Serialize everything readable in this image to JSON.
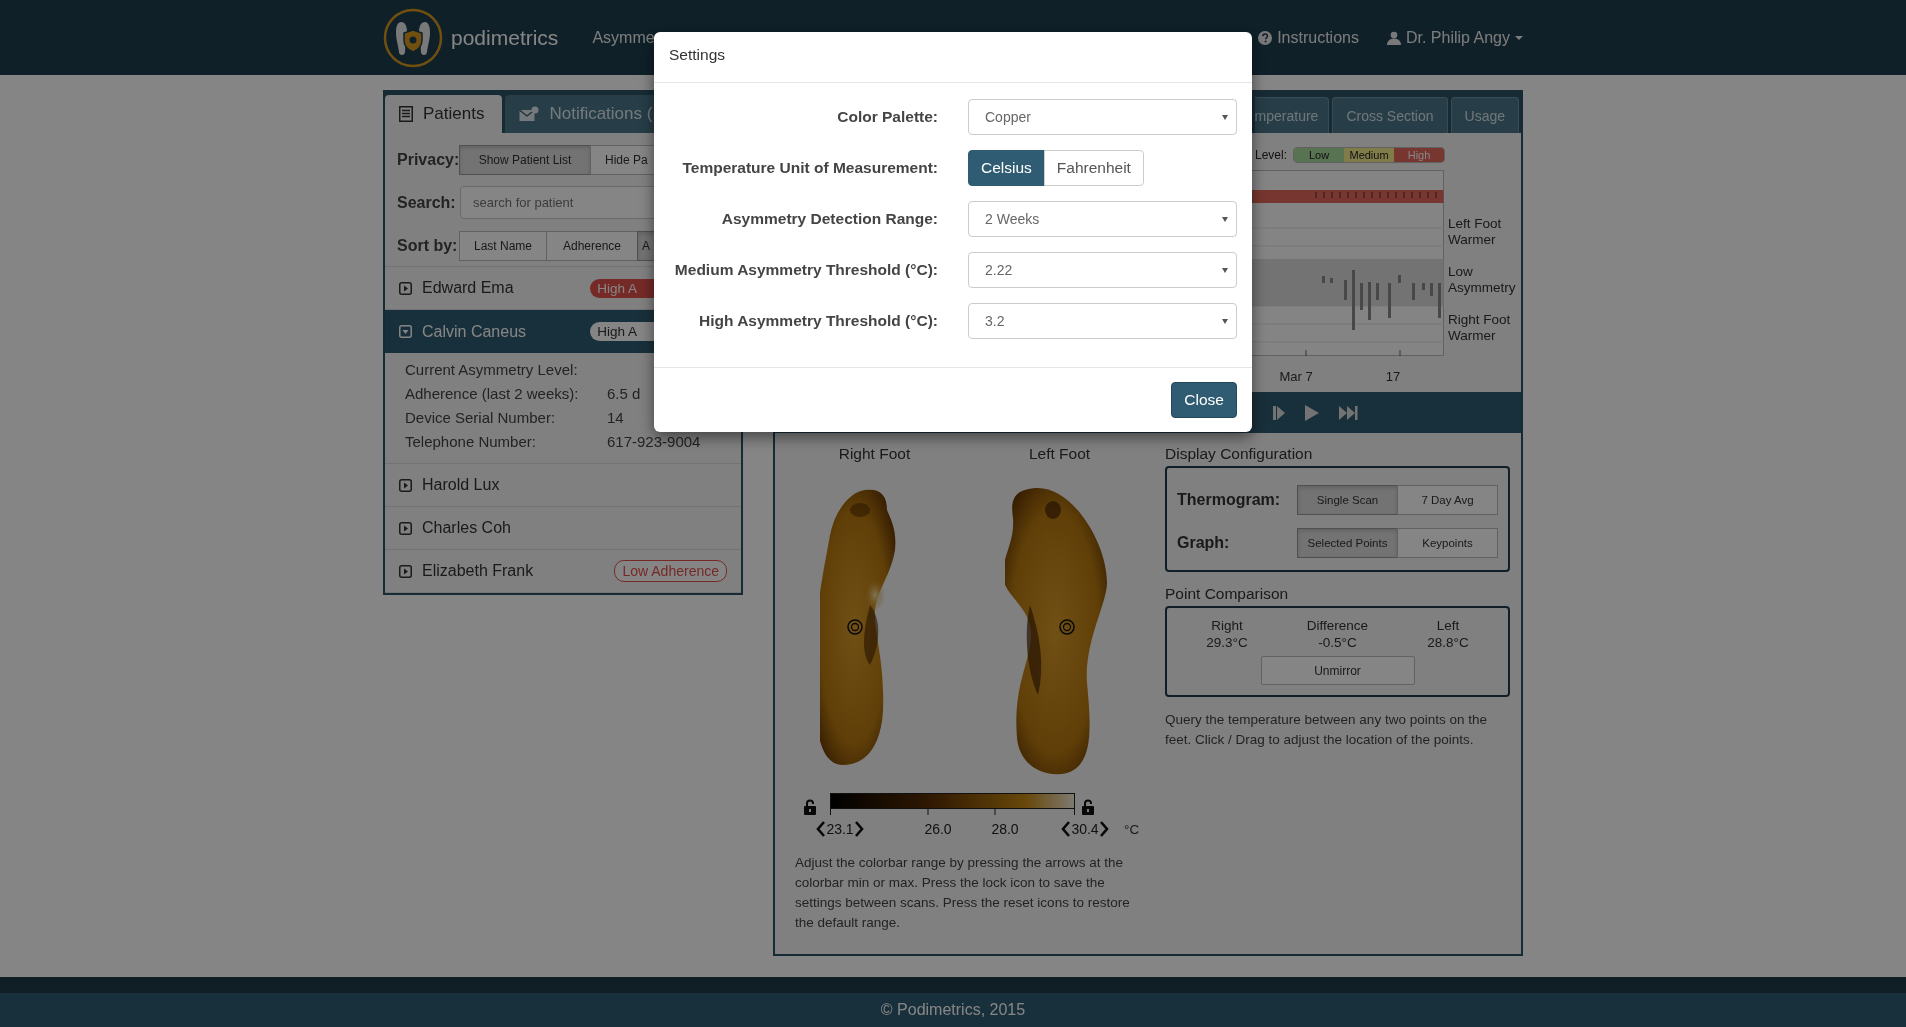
{
  "navbar": {
    "brand": "podimetrics",
    "nav_items": [
      {
        "label": "Asymme"
      }
    ],
    "right_items": [
      {
        "kind": "help",
        "label": "Instructions"
      },
      {
        "kind": "user",
        "label": "Dr. Philip Angy"
      }
    ]
  },
  "left_panel": {
    "tabs": [
      {
        "kind": "patients",
        "label": "Patients",
        "selected": true
      },
      {
        "kind": "notifications",
        "label": "Notifications (",
        "selected": false
      }
    ],
    "privacy": {
      "label": "Privacy:",
      "options": [
        {
          "label": "Show Patient List",
          "selected": true
        },
        {
          "label": "Hide Pa",
          "selected": false
        }
      ]
    },
    "search": {
      "label": "Search:",
      "placeholder": "search for patient"
    },
    "sort": {
      "label": "Sort by:",
      "options": [
        {
          "label": "Last Name",
          "selected": false
        },
        {
          "label": "Adherence",
          "selected": false
        },
        {
          "label": "A",
          "selected": true
        }
      ]
    },
    "patients": [
      {
        "name": "Edward Ema",
        "expanded": false,
        "badge": {
          "kind": "asymmetry",
          "text": "High A"
        }
      },
      {
        "name": "Calvin Caneus",
        "expanded": true,
        "badge": {
          "kind": "asymmetry",
          "text": "High A"
        },
        "details": [
          {
            "label": "Current Asymmetry Level:"
          },
          {
            "label": "Adherence (last 2 weeks):",
            "value": "6.5 d"
          },
          {
            "label": "Device Serial Number:",
            "value": "14"
          },
          {
            "label": "Telephone Number:",
            "value": "617-923-9004"
          }
        ]
      },
      {
        "name": "Harold Lux",
        "expanded": false
      },
      {
        "name": "Charles Coh",
        "expanded": false
      },
      {
        "name": "Elizabeth Frank",
        "expanded": false,
        "badge": {
          "kind": "adherence",
          "text": "Low Adherence"
        }
      }
    ]
  },
  "right_panel": {
    "tabs": [
      {
        "label": "mperature",
        "selected": false
      },
      {
        "label": "Cross Section",
        "selected": false
      },
      {
        "label": "Usage",
        "selected": false
      }
    ],
    "level_legend": {
      "label": "Level:",
      "levels": [
        {
          "label": "Low",
          "kind": "low"
        },
        {
          "label": "Medium",
          "kind": "medium"
        },
        {
          "label": "High",
          "kind": "high"
        }
      ]
    },
    "chart": {
      "side_labels": [
        "Left Foot Warmer",
        "Low Asymmetry",
        "Right Foot Warmer"
      ],
      "x_labels": [
        "Mar 7",
        "17"
      ]
    },
    "feet": {
      "titles": [
        "Right Foot",
        "Left Foot"
      ],
      "colorbar": {
        "min": "23.1",
        "ticks": [
          "26.0",
          "28.0"
        ],
        "max": "30.4",
        "unit": "°C"
      },
      "help": "Adjust the colorbar range by pressing the arrows at the colorbar min or max. Press the lock icon to save the settings between scans. Press the reset icons to restore the default range."
    },
    "display_configuration": {
      "title": "Display Configuration",
      "rows": [
        {
          "label": "Thermogram:",
          "options": [
            {
              "label": "Single Scan",
              "selected": true
            },
            {
              "label": "7 Day Avg",
              "selected": false
            }
          ]
        },
        {
          "label": "Graph:",
          "options": [
            {
              "label": "Selected Points",
              "selected": true
            },
            {
              "label": "Keypoints",
              "selected": false
            }
          ]
        }
      ]
    },
    "point_comparison": {
      "title": "Point Comparison",
      "columns": [
        {
          "label": "Right",
          "value": "29.3°C"
        },
        {
          "label": "Difference",
          "value": "-0.5°C"
        },
        {
          "label": "Left",
          "value": "28.8°C"
        }
      ],
      "button": "Unmirror",
      "help": "Query the temperature between any two points on the feet. Click / Drag to adjust the location of the points."
    }
  },
  "modal": {
    "title": "Settings",
    "fields": [
      {
        "kind": "select",
        "label": "Color Palette:",
        "value": "Copper"
      },
      {
        "kind": "toggle",
        "label": "Temperature Unit of Measurement:",
        "options": [
          {
            "label": "Celsius",
            "selected": true
          },
          {
            "label": "Fahrenheit",
            "selected": false
          }
        ]
      },
      {
        "kind": "select",
        "label": "Asymmetry Detection Range:",
        "value": "2 Weeks"
      },
      {
        "kind": "select",
        "label": "Medium Asymmetry Threshold (°C):",
        "value": "2.22"
      },
      {
        "kind": "select",
        "label": "High Asymmetry Threshold (°C):",
        "value": "3.2"
      }
    ],
    "close": "Close"
  },
  "footer": {
    "text": "© Podimetrics, 2015"
  }
}
